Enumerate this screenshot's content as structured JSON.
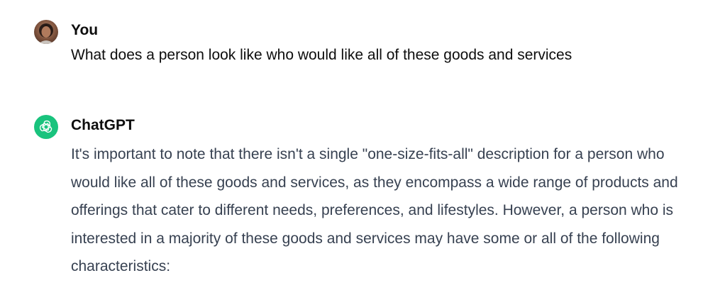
{
  "conversation": {
    "user_message": {
      "author": "You",
      "avatar_icon": "user-avatar-photo",
      "text": "What does a person look like who would like all of these goods and services"
    },
    "assistant_message": {
      "author": "ChatGPT",
      "avatar_icon": "openai-logo",
      "brand_color": "#19c37d",
      "text": "It's important to note that there isn't a single \"one-size-fits-all\" description for a person who would like all of these goods and services, as they encompass a wide range of products and offerings that cater to different needs, preferences, and lifestyles. However, a person who is interested in a majority of these goods and services may have some or all of the following characteristics:"
    }
  }
}
